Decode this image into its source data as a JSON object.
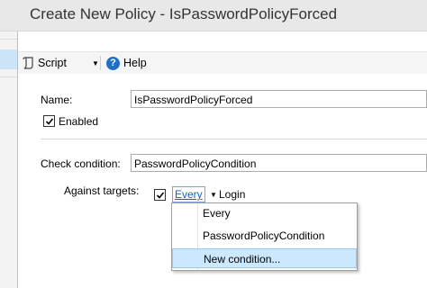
{
  "window": {
    "title": "Create New Policy - IsPasswordPolicyForced"
  },
  "toolbar": {
    "script_label": "Script",
    "help_label": "Help"
  },
  "form": {
    "name_label": "Name:",
    "name_value": "IsPasswordPolicyForced",
    "enabled_label": "Enabled",
    "enabled_checked": true,
    "check_condition_label": "Check condition:",
    "check_condition_value": "PasswordPolicyCondition",
    "against_targets_label": "Against targets:",
    "target_checked": true,
    "target_selector": "Every",
    "target_object": "Login"
  },
  "dropdown": {
    "options": [
      "Every",
      "PasswordPolicyCondition",
      "New condition..."
    ],
    "highlighted_index": 2
  }
}
